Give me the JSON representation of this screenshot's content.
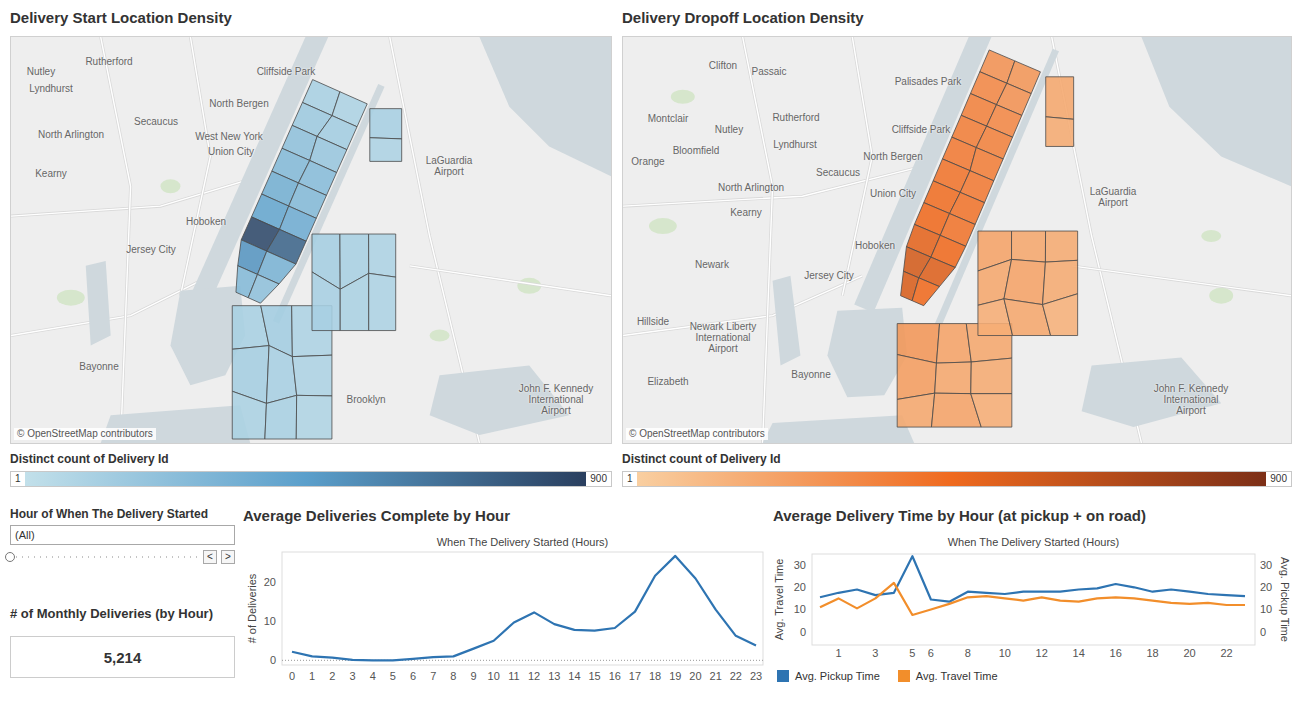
{
  "maps": [
    {
      "title": "Delivery Start Location Density",
      "attribution": "© OpenStreetMap contributors",
      "legend": {
        "title": "Distinct count of Delivery Id",
        "min": "1",
        "max": "900"
      },
      "color": "#2a3f5f",
      "labels": [
        "Nutley",
        "Rutherford",
        "Lyndhurst",
        "Cliffside Park",
        "North Bergen",
        "Secaucus",
        "North Arlington",
        "West New York",
        "Union City",
        "LaGuardia\nAirport",
        "Kearny",
        "Hoboken",
        "Jersey City",
        "Bayonne",
        "Brooklyn",
        "John F. Kennedy\nInternational\nAirport"
      ],
      "manhattan_zones": [
        0.12,
        0.1,
        0.18,
        0.15,
        0.25,
        0.2,
        0.3,
        0.28,
        0.38,
        0.3,
        0.45,
        0.4,
        0.95,
        0.8,
        0.55,
        0.35,
        0.3,
        0.25
      ],
      "outer_zones": [
        0.12,
        0.15,
        0.1,
        0.14,
        0.13,
        0.1,
        0.11,
        0.12,
        0.09,
        0.14,
        0.12,
        0.1,
        0.13,
        0.11,
        0.1,
        0.13,
        0.1
      ]
    },
    {
      "title": "Delivery Dropoff Location Density",
      "attribution": "© OpenStreetMap contributors",
      "legend": {
        "title": "Distinct count of Delivery Id",
        "min": "1",
        "max": "900"
      },
      "color": "#7c2f17",
      "labels": [
        "Clifton",
        "Passaic",
        "Palisades Park",
        "Montclair",
        "Rutherford",
        "Nutley",
        "Cliffside Park",
        "Bloomfield",
        "Lyndhurst",
        "North Bergen",
        "Secaucus",
        "North Arlington",
        "Union City",
        "Orange",
        "Kearny",
        "LaGuardia\nAirport",
        "Newark",
        "Hoboken",
        "Jersey City",
        "Hillside",
        "Newark Liberty\nInternational\nAirport",
        "Bayonne",
        "Elizabeth",
        "John F. Kennedy\nInternational\nAirport"
      ],
      "manhattan_zones": [
        0.3,
        0.28,
        0.35,
        0.3,
        0.38,
        0.35,
        0.4,
        0.38,
        0.42,
        0.4,
        0.45,
        0.42,
        0.48,
        0.45,
        0.5,
        0.45,
        0.55,
        0.5,
        0.62,
        0.58,
        0.6,
        0.5
      ],
      "outer_zones": [
        0.28,
        0.22,
        0.2,
        0.25,
        0.2,
        0.18,
        0.2,
        0.22,
        0.17,
        0.22,
        0.2,
        0.18,
        0.2,
        0.22,
        0.18,
        0.17,
        0.2,
        0.15,
        0.2,
        0.18
      ]
    }
  ],
  "filter": {
    "title": "Hour of When The Delivery Started",
    "value": "(All)",
    "slider": {
      "level": 0
    },
    "prev": "<",
    "next": ">"
  },
  "kpi": {
    "title": "# of Monthly Deliveries (by Hour)",
    "value": "5,214"
  },
  "deliveries_chart": {
    "title": "Average Deliveries Complete by Hour",
    "subtitle": "When The Delivery Started (Hours)",
    "y_label": "# of Deliveries",
    "y_ticks": [
      "0",
      "10",
      "20"
    ],
    "x_ticks": [
      "0",
      "1",
      "2",
      "3",
      "4",
      "5",
      "6",
      "7",
      "8",
      "9",
      "10",
      "11",
      "12",
      "13",
      "14",
      "15",
      "16",
      "17",
      "18",
      "19",
      "20",
      "21",
      "22",
      "23"
    ],
    "values": [
      2.2,
      1.0,
      0.7,
      0.1,
      0,
      0,
      0.4,
      0.8,
      1.0,
      3.0,
      5.0,
      9.7,
      12.3,
      9.3,
      7.8,
      7.6,
      8.3,
      12.5,
      21.7,
      26.8,
      21.0,
      13.0,
      6.3,
      3.8
    ]
  },
  "time_chart": {
    "title": "Average Delivery Time by Hour (at pickup + on road)",
    "subtitle": "When The Delivery Started (Hours)",
    "y_left_label": "Avg. Travel Time",
    "y_right_label": "Avg. Pickup Time",
    "y_left_ticks": [
      "0",
      "10",
      "20",
      "30"
    ],
    "y_right_ticks": [
      "0",
      "10",
      "20",
      "30"
    ],
    "x_ticks": [
      "1",
      "3",
      "5",
      "6",
      "8",
      "10",
      "12",
      "14",
      "16",
      "18",
      "20",
      "22"
    ],
    "series": [
      {
        "name": "Avg. Pickup Time",
        "color": "#2e74b2",
        "values": [
          15.5,
          17.5,
          19,
          16.5,
          17.5,
          34,
          14.5,
          13.5,
          18,
          17.5,
          17,
          18,
          18,
          18,
          19,
          19.5,
          21.5,
          20,
          18,
          19,
          18,
          17,
          16.5,
          16
        ]
      },
      {
        "name": "Avg. Travel Time",
        "color": "#f28e2b",
        "values": [
          11,
          15,
          10.5,
          15,
          22,
          7.5,
          10,
          12.5,
          15.5,
          16,
          15,
          14,
          15.5,
          14,
          13.5,
          15,
          15.5,
          15,
          14,
          13,
          12.5,
          13,
          12,
          12
        ]
      }
    ]
  }
}
